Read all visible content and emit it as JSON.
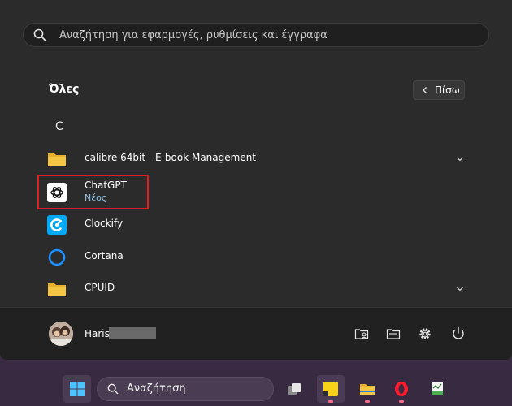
{
  "search": {
    "placeholder": "Αναζήτηση για εφαρμογές, ρυθμίσεις και έγγραφα"
  },
  "all_apps": {
    "title": "Όλες",
    "back_label": "Πίσω",
    "letter": "C"
  },
  "apps": [
    {
      "name": "calibre 64bit - E-book Management",
      "icon": "folder-icon",
      "expandable": true
    },
    {
      "name": "ChatGPT",
      "sub": "Νέος",
      "icon": "chatgpt-icon",
      "highlighted": true
    },
    {
      "name": "Clockify",
      "icon": "clockify-icon"
    },
    {
      "name": "Cortana",
      "icon": "cortana-icon"
    },
    {
      "name": "CPUID",
      "icon": "folder-icon",
      "expandable": true
    }
  ],
  "footer": {
    "user_name": "Haris"
  },
  "taskbar": {
    "search_label": "Αναζήτηση"
  },
  "colors": {
    "highlight": "#e02020",
    "accent": "#8ec3e6",
    "clockify": "#03a9f4",
    "cortana": "#1e90ff",
    "folder": "#f4c542"
  }
}
